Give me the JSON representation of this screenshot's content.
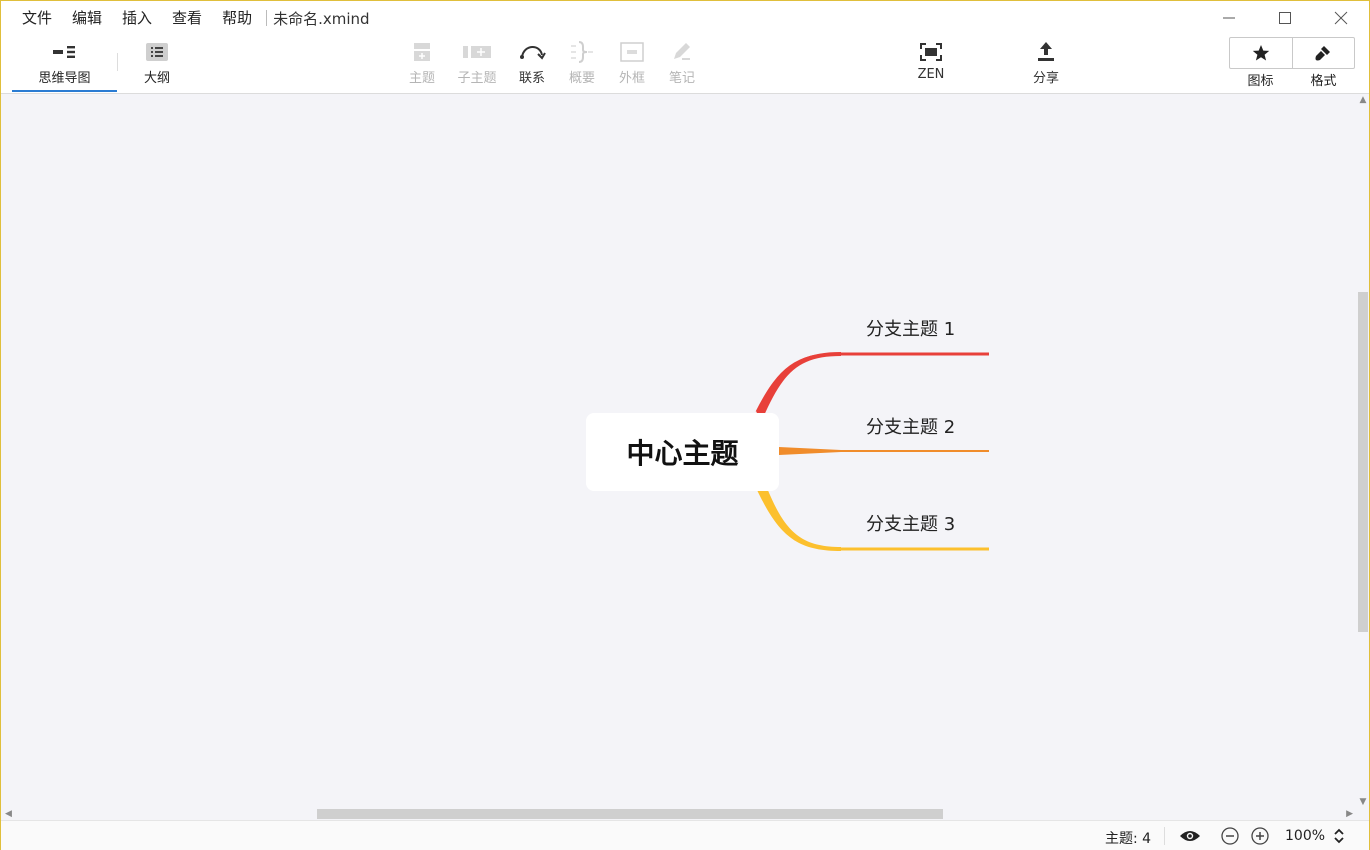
{
  "menu": {
    "items": [
      "文件",
      "编辑",
      "插入",
      "查看",
      "帮助"
    ],
    "doc_title": "未命名.xmind"
  },
  "window_controls": {
    "minimize": "—",
    "maximize": "☐",
    "close": "✕"
  },
  "toolbar": {
    "views": {
      "mindmap": "思维导图",
      "outline": "大纲"
    },
    "topic": "主题",
    "subtopic": "子主题",
    "relationship": "联系",
    "summary": "概要",
    "boundary": "外框",
    "note": "笔记",
    "zen": "ZEN",
    "share": "分享",
    "icons": "图标",
    "format": "格式"
  },
  "mindmap": {
    "central_topic": "中心主题",
    "branches": [
      {
        "label": "分支主题 1",
        "color": "#e8403a"
      },
      {
        "label": "分支主题 2",
        "color": "#f08c2b"
      },
      {
        "label": "分支主题 3",
        "color": "#fcc02e"
      }
    ]
  },
  "status": {
    "topics": "主题: 4",
    "zoom": "100%"
  },
  "colors": {
    "accent": "#2b7cd3",
    "canvas": "#f4f4f8",
    "window_border": "#e0bf3b"
  }
}
